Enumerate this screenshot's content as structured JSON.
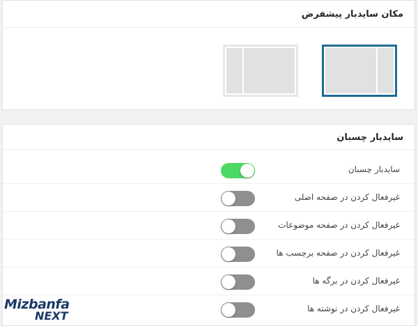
{
  "layout_section": {
    "title": "مکان سایدبار پیشفرض",
    "options": [
      {
        "id": "sidebar-right",
        "selected": true
      },
      {
        "id": "sidebar-left",
        "selected": false
      }
    ]
  },
  "sticky_section": {
    "title": "سایدبار چسبان",
    "rows": [
      {
        "label": "سایدبار چسبان",
        "enabled": true
      },
      {
        "label": "غیرفعال کردن در صفحه اصلی",
        "enabled": false
      },
      {
        "label": "غیرفعال کردن در صفحه موضوعات",
        "enabled": false
      },
      {
        "label": "غیرفعال کردن در صفحه برچسب ها",
        "enabled": false
      },
      {
        "label": "غیرفعال کردن در برگه ها",
        "enabled": false
      },
      {
        "label": "غیرفعال کردن در نوشته ها",
        "enabled": false
      }
    ]
  },
  "colors": {
    "selected_border": "#1e6c95",
    "toggle_on": "#4cd964",
    "toggle_off": "#8f8f8f"
  },
  "watermark": {
    "line1": "Mizbanfa",
    "line2": "NEXT"
  }
}
